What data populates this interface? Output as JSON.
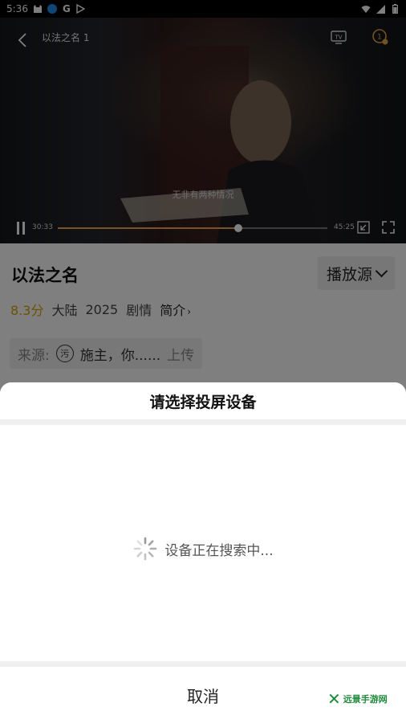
{
  "status_bar": {
    "time": "5:36",
    "icons": [
      "cat-icon",
      "bluetooth-app-icon",
      "google-icon",
      "play-store-icon",
      "wifi-icon",
      "signal-icon",
      "battery-icon"
    ]
  },
  "player": {
    "title": "以法之名 1",
    "subtitle": "无非有两种情况",
    "current_time": "30:33",
    "total_time": "45:25",
    "progress": 0.67,
    "colors": {
      "progress": "#f2a64a"
    }
  },
  "details": {
    "title": "以法之名",
    "source_button": "播放源",
    "score": "8.3分",
    "region": "大陆",
    "year": "2025",
    "genre": "剧情",
    "intro_link": "简介",
    "uploader_prefix": "来源:",
    "uploader_avatar": "污",
    "uploader_name": "施主，你......",
    "uploader_suffix": "上传"
  },
  "cast_sheet": {
    "title": "请选择投屏设备",
    "status": "设备正在搜索中...",
    "cancel": "取消"
  },
  "watermark": {
    "text": "远景手游网"
  }
}
